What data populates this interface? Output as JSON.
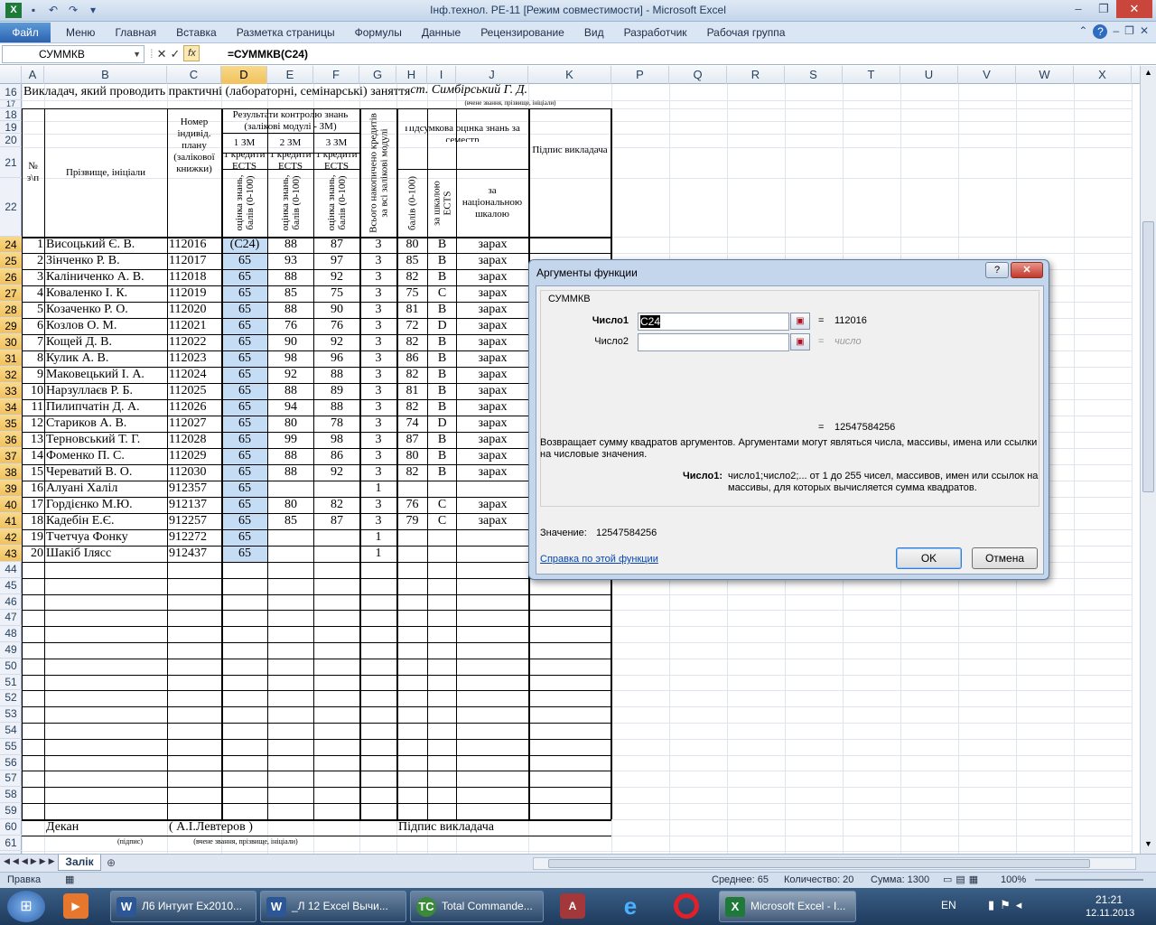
{
  "window": {
    "title": "Інф.технол. РЕ-11  [Режим совместимости]  -  Microsoft Excel"
  },
  "ribbon": {
    "file": "Файл",
    "tabs": [
      "Меню",
      "Главная",
      "Вставка",
      "Разметка страницы",
      "Формулы",
      "Данные",
      "Рецензирование",
      "Вид",
      "Разработчик",
      "Рабочая группа"
    ]
  },
  "formula_bar": {
    "name_box": "СУММКВ",
    "formula": "=СУММКВ(C24)"
  },
  "columns": [
    "A",
    "B",
    "C",
    "D",
    "E",
    "F",
    "G",
    "H",
    "I",
    "J",
    "K",
    "P",
    "Q",
    "R",
    "S",
    "T",
    "U",
    "V",
    "W",
    "X"
  ],
  "rows": [
    "16",
    "17",
    "18",
    "19",
    "20",
    "21",
    "22",
    "24",
    "25",
    "26",
    "27",
    "28",
    "29",
    "30",
    "31",
    "32",
    "33",
    "34",
    "35",
    "36",
    "37",
    "38",
    "39",
    "40",
    "41",
    "42",
    "43",
    "44",
    "45",
    "46",
    "47",
    "48",
    "49",
    "50",
    "51",
    "52",
    "53",
    "54",
    "55",
    "56",
    "57",
    "58",
    "59",
    "60",
    "61"
  ],
  "sheet": {
    "row16_text": "Викладач, який проводить практичні (лабораторні, семінарські) заняття",
    "row16_teacher": "ст. Симбірський Г. Д.",
    "row17_note": "(вчене звання, прізвище, ініціали)",
    "hdr_num": "№ з\\п",
    "hdr_name": "Прізвище, ініціали",
    "hdr_plan": "Номер індивід. плану (залікової книжки)",
    "hdr_results": "Результати контролю знань (залікові модулі - ЗМ)",
    "hdr_zm1": "1 ЗМ",
    "hdr_zm2": "2 ЗМ",
    "hdr_zm3": "3 ЗМ",
    "hdr_credit": "1 кредити ECTS",
    "hdr_score": "оцінка знань, балів (0-100)",
    "hdr_total_credits": "Всього накопичено кредитів за всі залікові модулі",
    "hdr_final": "Підсумкова оцінка знань за семестр",
    "hdr_points": "балів (0-100)",
    "hdr_ects": "за шкалою ECTS",
    "hdr_national": "за національною шкалою",
    "hdr_signature": "Підпис викладача",
    "students": [
      {
        "n": "1",
        "name": "Висоцький Є. В.",
        "id": "112016",
        "d": "(C24)",
        "e": "88",
        "f": "87",
        "g": "3",
        "h": "80",
        "i": "B",
        "j": "зарах"
      },
      {
        "n": "2",
        "name": "Зінченко Р. В.",
        "id": "112017",
        "d": "65",
        "e": "93",
        "f": "97",
        "g": "3",
        "h": "85",
        "i": "B",
        "j": "зарах"
      },
      {
        "n": "3",
        "name": "Каліниченко А. В.",
        "id": "112018",
        "d": "65",
        "e": "88",
        "f": "92",
        "g": "3",
        "h": "82",
        "i": "B",
        "j": "зарах"
      },
      {
        "n": "4",
        "name": "Коваленко І. К.",
        "id": "112019",
        "d": "65",
        "e": "85",
        "f": "75",
        "g": "3",
        "h": "75",
        "i": "C",
        "j": "зарах"
      },
      {
        "n": "5",
        "name": "Козаченко Р. О.",
        "id": "112020",
        "d": "65",
        "e": "88",
        "f": "90",
        "g": "3",
        "h": "81",
        "i": "B",
        "j": "зарах"
      },
      {
        "n": "6",
        "name": "Козлов О. М.",
        "id": "112021",
        "d": "65",
        "e": "76",
        "f": "76",
        "g": "3",
        "h": "72",
        "i": "D",
        "j": "зарах"
      },
      {
        "n": "7",
        "name": "Кощей Д. В.",
        "id": "112022",
        "d": "65",
        "e": "90",
        "f": "92",
        "g": "3",
        "h": "82",
        "i": "B",
        "j": "зарах"
      },
      {
        "n": "8",
        "name": "Кулик А. В.",
        "id": "112023",
        "d": "65",
        "e": "98",
        "f": "96",
        "g": "3",
        "h": "86",
        "i": "B",
        "j": "зарах"
      },
      {
        "n": "9",
        "name": "Маковецький І. А.",
        "id": "112024",
        "d": "65",
        "e": "92",
        "f": "88",
        "g": "3",
        "h": "82",
        "i": "B",
        "j": "зарах"
      },
      {
        "n": "10",
        "name": "Нарзуллаєв Р. Б.",
        "id": "112025",
        "d": "65",
        "e": "88",
        "f": "89",
        "g": "3",
        "h": "81",
        "i": "B",
        "j": "зарах"
      },
      {
        "n": "11",
        "name": "Пилипчатін Д. А.",
        "id": "112026",
        "d": "65",
        "e": "94",
        "f": "88",
        "g": "3",
        "h": "82",
        "i": "B",
        "j": "зарах"
      },
      {
        "n": "12",
        "name": "Стариков А. В.",
        "id": "112027",
        "d": "65",
        "e": "80",
        "f": "78",
        "g": "3",
        "h": "74",
        "i": "D",
        "j": "зарах"
      },
      {
        "n": "13",
        "name": "Терновський Т. Г.",
        "id": "112028",
        "d": "65",
        "e": "99",
        "f": "98",
        "g": "3",
        "h": "87",
        "i": "B",
        "j": "зарах"
      },
      {
        "n": "14",
        "name": "Фоменко П. С.",
        "id": "112029",
        "d": "65",
        "e": "88",
        "f": "86",
        "g": "3",
        "h": "80",
        "i": "B",
        "j": "зарах"
      },
      {
        "n": "15",
        "name": "Череватий В. О.",
        "id": "112030",
        "d": "65",
        "e": "88",
        "f": "92",
        "g": "3",
        "h": "82",
        "i": "B",
        "j": "зарах"
      },
      {
        "n": "16",
        "name": "Алуані Халіл",
        "id": "912357",
        "d": "65",
        "e": "",
        "f": "",
        "g": "1",
        "h": "",
        "i": "",
        "j": ""
      },
      {
        "n": "17",
        "name": "Гордієнко М.Ю.",
        "id": "912137",
        "d": "65",
        "e": "80",
        "f": "82",
        "g": "3",
        "h": "76",
        "i": "C",
        "j": "зарах"
      },
      {
        "n": "18",
        "name": "Кадебін Е.Є.",
        "id": "912257",
        "d": "65",
        "e": "85",
        "f": "87",
        "g": "3",
        "h": "79",
        "i": "C",
        "j": "зарах"
      },
      {
        "n": "19",
        "name": "Тчетчуа Фонку",
        "id": "912272",
        "d": "65",
        "e": "",
        "f": "",
        "g": "1",
        "h": "",
        "i": "",
        "j": ""
      },
      {
        "n": "20",
        "name": "Шакіб Ілясс",
        "id": "912437",
        "d": "65",
        "e": "",
        "f": "",
        "g": "1",
        "h": "",
        "i": "",
        "j": ""
      }
    ],
    "dean_label": "Декан",
    "dean_name": "(    А.І.Левтеров              )",
    "sign_teacher": "Підпис викладача",
    "row61_a": "(підпис)",
    "row61_b": "(вчене звання, прізвище, ініціали)"
  },
  "sheet_tab": "Залік",
  "dialog": {
    "title": "Аргументы функции",
    "func": "СУММКВ",
    "arg1_label": "Число1",
    "arg1_value": "C24",
    "arg1_result": "112016",
    "arg2_label": "Число2",
    "arg2_result": "число",
    "eq": "=",
    "total_result": "12547584256",
    "description": "Возвращает сумму квадратов аргументов. Аргументами могут являться числа, массивы, имена или ссылки на числовые значения.",
    "arg_help_label": "Число1:",
    "arg_help_text": "число1;число2;... от 1 до 255 чисел, массивов, имен или ссылок на массивы, для которых вычисляется сумма квадратов.",
    "value_label": "Значение:",
    "value": "12547584256",
    "help_link": "Справка по этой функции",
    "ok": "OK",
    "cancel": "Отмена"
  },
  "status": {
    "mode": "Правка",
    "average": "Среднее: 65",
    "count": "Количество: 20",
    "sum": "Сумма: 1300",
    "zoom": "100%"
  },
  "taskbar": {
    "items": [
      "Л6 Интуит Ex2010...",
      "_Л 12 Excel Вычи...",
      "Total Commande...",
      "Microsoft Excel - І..."
    ],
    "lang": "EN",
    "time": "21:21",
    "date": "12.11.2013"
  }
}
